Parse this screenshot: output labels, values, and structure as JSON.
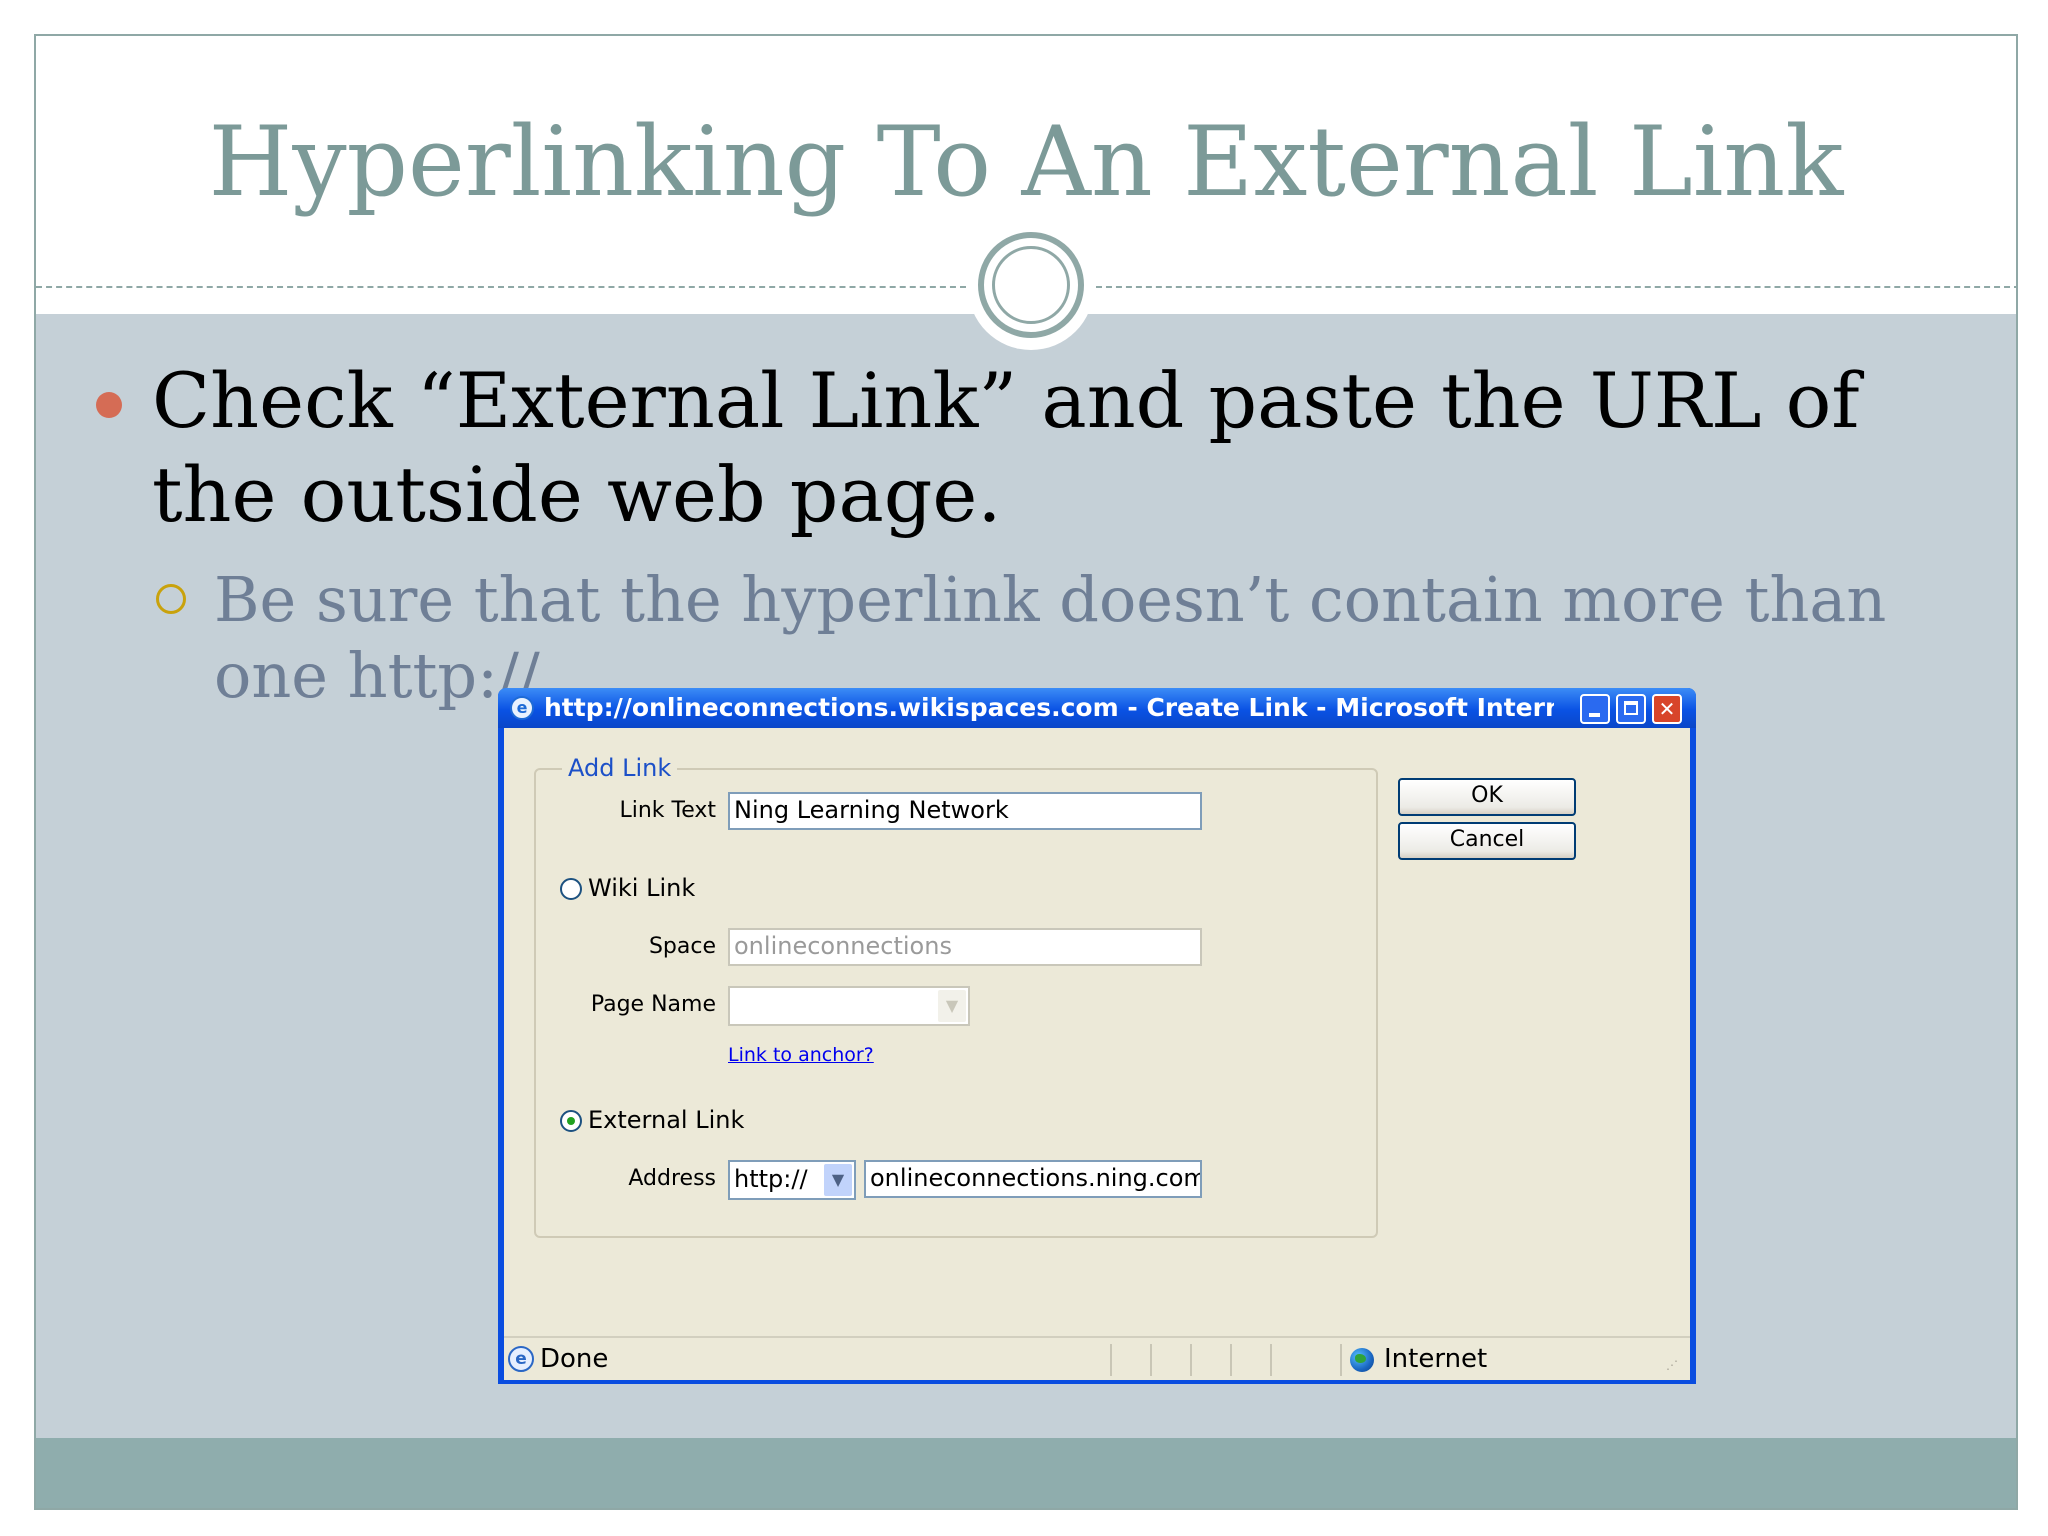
{
  "slide": {
    "title": "Hyperlinking To An External Link",
    "bullet": "Check “External Link” and paste the URL of the outside web page.",
    "sub_bullet": "Be sure that the hyperlink doesn’t contain more than one http://",
    "colors": {
      "title": "#7c9a98",
      "content_bg": "#c5d0d7",
      "footer_bg": "#8fadad",
      "bullet": "#d56c55",
      "sub_bullet_marker": "#c9a20c",
      "sub_text": "#6f7f96"
    }
  },
  "window": {
    "title": "http://onlineconnections.wikispaces.com - Create Link - Microsoft Internet ...",
    "controls": {
      "minimize_icon": "minimize-icon",
      "maximize_icon": "maximize-icon",
      "close_icon": "close-icon"
    },
    "dialog": {
      "group_title": "Add Link",
      "link_text_label": "Link Text",
      "link_text_value": "Ning Learning Network",
      "wiki_link_label": "Wiki Link",
      "wiki_link_selected": false,
      "space_label": "Space",
      "space_value": "onlineconnections",
      "page_name_label": "Page Name",
      "page_name_value": "",
      "anchor_link": "Link to anchor?",
      "external_link_label": "External Link",
      "external_link_selected": true,
      "address_label": "Address",
      "protocol_value": "http://",
      "address_value": "onlineconnections.ning.com",
      "ok_label": "OK",
      "cancel_label": "Cancel"
    },
    "status": {
      "text": "Done",
      "zone": "Internet"
    }
  }
}
